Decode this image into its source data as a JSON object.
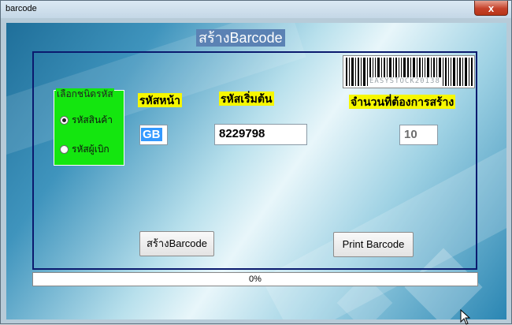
{
  "window": {
    "title": "barcode",
    "close_glyph": "x"
  },
  "heading": "สร้างBarcode",
  "barcode_preview": {
    "text": "EASYSTOCK20138"
  },
  "code_type_group": {
    "legend": "เลือกชนิดรหัส",
    "options": [
      {
        "label": "รหัสสินค้า",
        "selected": true
      },
      {
        "label": "รหัสผู้เบิก",
        "selected": false
      }
    ]
  },
  "prefix": {
    "label": "รหัสหน้า",
    "value": "GB"
  },
  "start_code": {
    "label": "รหัสเริ่มต้น",
    "value": "8229798"
  },
  "quantity": {
    "label": "จำนวนที่ต้องการสร้าง",
    "value": "10"
  },
  "buttons": {
    "create": "สร้างBarcode",
    "print": "Print Barcode"
  },
  "progress": {
    "value": 0,
    "text": "0%"
  },
  "colors": {
    "group_background": "#14e60f",
    "label_highlight": "#f6f700",
    "panel_border": "#0b1a6e",
    "heading_background": "#5b82b4"
  },
  "icons": [
    "close-icon",
    "barcode-icon",
    "mouse-cursor-icon"
  ]
}
